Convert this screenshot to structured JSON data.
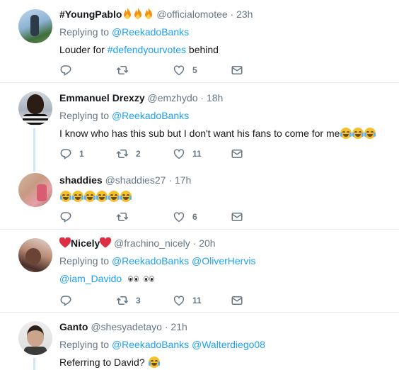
{
  "tweets": [
    {
      "name": "#YoungPablo",
      "name_suffix_icons": [
        "fire-emoji",
        "fire-emoji",
        "fire-emoji"
      ],
      "handle": "@officialomotee",
      "time": "23h",
      "replying_to_label": "Replying to",
      "replying_to": [
        "@ReekadoBanks"
      ],
      "text_before": "Louder for",
      "hashtag": "#defendyourvotes",
      "text_after": "behind",
      "reply_count": "",
      "retweet_count": "",
      "like_count": "5"
    },
    {
      "name": "Emmanuel Drexzy",
      "handle": "@emzhydo",
      "time": "18h",
      "replying_to_label": "Replying to",
      "replying_to": [
        "@ReekadoBanks"
      ],
      "text": "I know who has this sub but I don't want his fans to come for me",
      "text_emojis": [
        "crying-face-emoji",
        "joy-emoji",
        "joy-emoji"
      ],
      "reply_count": "1",
      "retweet_count": "2",
      "like_count": "11"
    },
    {
      "name": "shaddies",
      "handle": "@shaddies27",
      "time": "17h",
      "text_emojis": [
        "joy-emoji",
        "joy-emoji",
        "joy-emoji",
        "joy-emoji",
        "joy-emoji",
        "joy-emoji"
      ],
      "reply_count": "",
      "retweet_count": "",
      "like_count": "6"
    },
    {
      "name": "Nicely",
      "name_icons": [
        "heart-emoji",
        "heart-emoji"
      ],
      "handle": "@frachino_nicely",
      "time": "20h",
      "replying_to_label": "Replying to",
      "replying_to": [
        "@ReekadoBanks",
        "@OliverHervis"
      ],
      "mention": "@iam_Davido",
      "text_emojis": [
        "eyes-emoji",
        "eyes-emoji"
      ],
      "reply_count": "",
      "retweet_count": "3",
      "like_count": "11"
    },
    {
      "name": "Ganto",
      "handle": "@shesyadetayo",
      "time": "21h",
      "replying_to_label": "Replying to",
      "replying_to": [
        "@ReekadoBanks",
        "@Walterdiego08"
      ],
      "text": "Referring to David?",
      "text_emojis": [
        "joy-emoji"
      ]
    }
  ],
  "dot": "·",
  "colors": {
    "link": "#1da1f2",
    "muted": "#657786",
    "thread": "#cce6fa",
    "divider": "#e6ecf0"
  }
}
